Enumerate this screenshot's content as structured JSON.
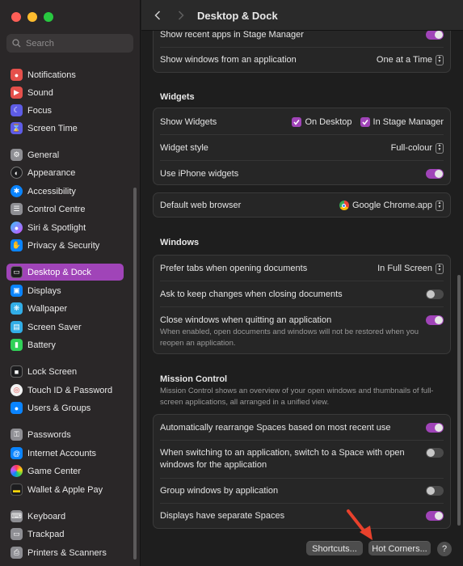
{
  "window": {
    "title": "Desktop & Dock"
  },
  "colors": {
    "accent": "#a044b8",
    "close": "#fe5f57",
    "minimize": "#febc2e",
    "zoom": "#28c840",
    "annotation_arrow": "#e8412c"
  },
  "search": {
    "placeholder": "Search"
  },
  "sidebar": {
    "items": [
      {
        "label": "Notifications",
        "icon": "bell-icon",
        "color": "#e5504b"
      },
      {
        "label": "Sound",
        "icon": "speaker-icon",
        "color": "#e5504b"
      },
      {
        "label": "Focus",
        "icon": "moon-icon",
        "color": "#5e5ce6"
      },
      {
        "label": "Screen Time",
        "icon": "hourglass-icon",
        "color": "#5e5ce6"
      },
      {
        "label": "General",
        "icon": "gear-icon",
        "color": "#8e8e93"
      },
      {
        "label": "Appearance",
        "icon": "appearance-icon",
        "color": "#1c1c1e"
      },
      {
        "label": "Accessibility",
        "icon": "accessibility-icon",
        "color": "#0a84ff"
      },
      {
        "label": "Control Centre",
        "icon": "control-centre-icon",
        "color": "#8e8e93"
      },
      {
        "label": "Siri & Spotlight",
        "icon": "siri-icon",
        "color": "#7d5cd6"
      },
      {
        "label": "Privacy & Security",
        "icon": "hand-icon",
        "color": "#0a84ff"
      },
      {
        "label": "Desktop & Dock",
        "icon": "dock-icon",
        "color": "#1c1c1e"
      },
      {
        "label": "Displays",
        "icon": "display-icon",
        "color": "#0a84ff"
      },
      {
        "label": "Wallpaper",
        "icon": "wallpaper-icon",
        "color": "#32ade6"
      },
      {
        "label": "Screen Saver",
        "icon": "screen-saver-icon",
        "color": "#32ade6"
      },
      {
        "label": "Battery",
        "icon": "battery-icon",
        "color": "#30d158"
      },
      {
        "label": "Lock Screen",
        "icon": "lock-icon",
        "color": "#1c1c1e"
      },
      {
        "label": "Touch ID & Password",
        "icon": "fingerprint-icon",
        "color": "#f2f2f2"
      },
      {
        "label": "Users & Groups",
        "icon": "users-icon",
        "color": "#0a84ff"
      },
      {
        "label": "Passwords",
        "icon": "key-icon",
        "color": "#8e8e93"
      },
      {
        "label": "Internet Accounts",
        "icon": "at-icon",
        "color": "#0a84ff"
      },
      {
        "label": "Game Center",
        "icon": "game-center-icon",
        "color": "#f2f2f2"
      },
      {
        "label": "Wallet & Apple Pay",
        "icon": "wallet-icon",
        "color": "#1c1c1e"
      },
      {
        "label": "Keyboard",
        "icon": "keyboard-icon",
        "color": "#8e8e93"
      },
      {
        "label": "Trackpad",
        "icon": "trackpad-icon",
        "color": "#8e8e93"
      },
      {
        "label": "Printers & Scanners",
        "icon": "printer-icon",
        "color": "#8e8e93"
      }
    ]
  },
  "top_panel": {
    "cut_label": "Show recent apps in Stage Manager",
    "windows_from_app_label": "Show windows from an application",
    "windows_from_app_value": "One at a Time"
  },
  "widgets": {
    "title": "Widgets",
    "show_widgets_label": "Show Widgets",
    "on_desktop_label": "On Desktop",
    "in_stage_manager_label": "In Stage Manager",
    "widget_style_label": "Widget style",
    "widget_style_value": "Full-colour",
    "iphone_widgets_label": "Use iPhone widgets"
  },
  "browser": {
    "label": "Default web browser",
    "value": "Google Chrome.app"
  },
  "windows": {
    "title": "Windows",
    "prefer_tabs_label": "Prefer tabs when opening documents",
    "prefer_tabs_value": "In Full Screen",
    "ask_keep_label": "Ask to keep changes when closing documents",
    "close_windows_label": "Close windows when quitting an application",
    "close_windows_desc_1": "When enabled, open documents and windows will not be restored when you",
    "close_windows_desc_2": "reopen an application."
  },
  "mission_control": {
    "title": "Mission Control",
    "desc_1": "Mission Control shows an overview of your open windows and thumbnails of full-",
    "desc_2": "screen applications, all arranged in a unified view.",
    "auto_rearrange_label": "Automatically rearrange Spaces based on most recent use",
    "switch_app_label_1": "When switching to an application, switch to a Space with open",
    "switch_app_label_2": "windows for the application",
    "group_windows_label": "Group windows by application",
    "separate_spaces_label": "Displays have separate Spaces"
  },
  "footer": {
    "shortcuts_label": "Shortcuts...",
    "hot_corners_label": "Hot Corners...",
    "help_label": "?"
  }
}
